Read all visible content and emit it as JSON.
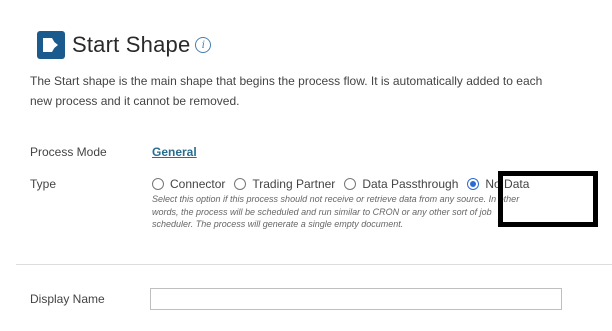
{
  "header": {
    "title": "Start Shape",
    "icon": "start-shape-icon",
    "info_icon": "info-icon",
    "accent_color": "#1a5a8c"
  },
  "description": {
    "line1": "The Start shape is the main shape that begins the process flow. It is automatically added to each",
    "line2": "new process and it cannot be removed."
  },
  "process_mode": {
    "label": "Process Mode",
    "value": "General"
  },
  "type": {
    "label": "Type",
    "options": [
      {
        "label": "Connector",
        "selected": false
      },
      {
        "label": "Trading Partner",
        "selected": false
      },
      {
        "label": "Data Passthrough",
        "selected": false
      },
      {
        "label": "No Data",
        "selected": true
      }
    ],
    "help_text": "Select this option if this process should not receive or retrieve data from any source. In other words, the process will be scheduled and run similar to CRON or any other sort of job scheduler. The process will generate a single empty document."
  },
  "display_name": {
    "label": "Display Name",
    "value": "",
    "placeholder": ""
  }
}
